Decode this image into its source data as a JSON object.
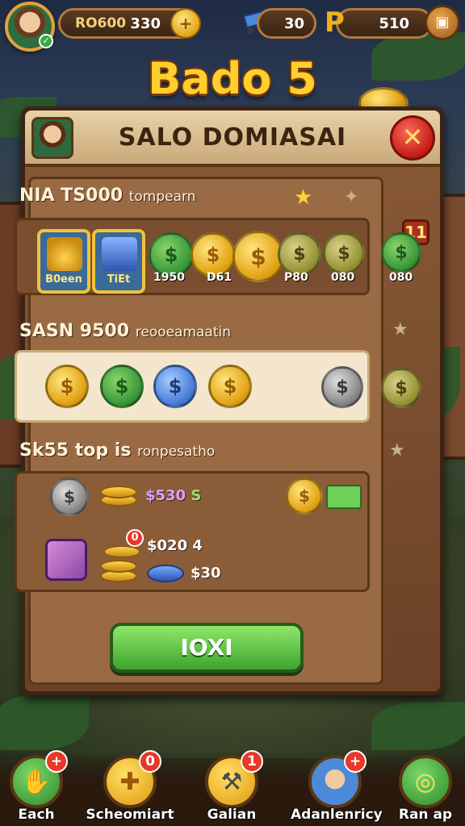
{
  "hud": {
    "player_name": "RO600",
    "coins": "330",
    "gems": "30",
    "keys": "510"
  },
  "game_title": "Bado 5",
  "panel": {
    "title": "SALO DOMIASAI",
    "close_symbol": "✕"
  },
  "sections": [
    {
      "title": "NIA TS000",
      "subtitle": "tompearn"
    },
    {
      "title": "SASN 9500",
      "subtitle": "reooeamaatin"
    },
    {
      "title": "Sk55 top is",
      "subtitle": "ronpesatho"
    }
  ],
  "row1_items": [
    {
      "caption": "B0een",
      "kind": "gold-pile"
    },
    {
      "caption": "TiEt",
      "kind": "blue-pot"
    }
  ],
  "row1_coin_caps": [
    "1950",
    "D61",
    "P80",
    "080"
  ],
  "side_badge": "11",
  "side_caption": "080",
  "row3": {
    "price1_a": "$530",
    "price1_b": "S",
    "price2_a": "$020",
    "price2_b": "4",
    "price3": "$30",
    "dot_symbol": "0"
  },
  "action_button": "IOXI",
  "bottom_nav": [
    {
      "label": "Each",
      "badge": "+",
      "icon": "hand-icon",
      "color": "#3aa84a"
    },
    {
      "label": "Scheomiart",
      "badge": "0",
      "icon": "plus-cross-icon",
      "color": "#f0b21a"
    },
    {
      "label": "Galian",
      "badge": "1",
      "icon": "hammer-icon",
      "color": "#f0b21a"
    },
    {
      "label": "Adanlenricy",
      "badge": "+",
      "icon": "character-icon",
      "color": "#4a8ad8"
    },
    {
      "label": "Ran ap",
      "badge": "",
      "icon": "ring-icon",
      "color": "#3aa84a"
    }
  ]
}
